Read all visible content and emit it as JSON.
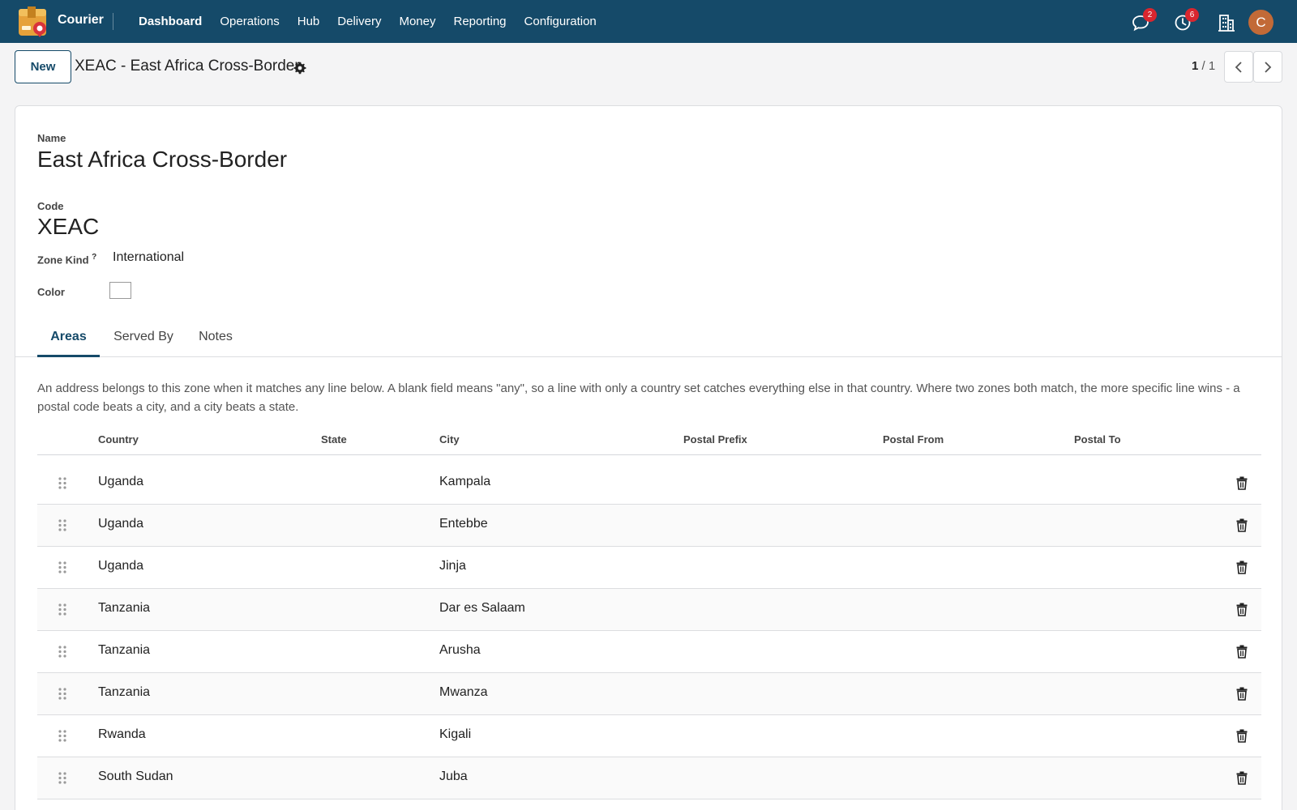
{
  "app": {
    "name": "Courier"
  },
  "menu": [
    {
      "label": "Dashboard",
      "active": true
    },
    {
      "label": "Operations"
    },
    {
      "label": "Hub"
    },
    {
      "label": "Delivery"
    },
    {
      "label": "Money"
    },
    {
      "label": "Reporting"
    },
    {
      "label": "Configuration"
    }
  ],
  "systray": {
    "messages_count": "2",
    "activities_count": "6",
    "avatar_initial": "C"
  },
  "control": {
    "new_label": "New",
    "breadcrumb": "XEAC - East Africa Cross-Border",
    "pager_current": "1",
    "pager_total": "/ 1"
  },
  "form": {
    "name_label": "Name",
    "name_value": "East Africa Cross-Border",
    "code_label": "Code",
    "code_value": "XEAC",
    "zone_kind_label": "Zone Kind",
    "zone_kind_help": "?",
    "zone_kind_value": "International",
    "color_label": "Color",
    "color_value": "#ffffff"
  },
  "tabs": [
    {
      "label": "Areas",
      "active": true
    },
    {
      "label": "Served By"
    },
    {
      "label": "Notes"
    }
  ],
  "areas_help": "An address belongs to this zone when it matches any line below. A blank field means \"any\", so a line with only a country set catches everything else in that country. Where two zones both match, the more specific line wins - a postal code beats a city, and a city beats a state.",
  "table": {
    "columns": [
      "Country",
      "State",
      "City",
      "Postal Prefix",
      "Postal From",
      "Postal To"
    ],
    "rows": [
      {
        "country": "Uganda",
        "state": "",
        "city": "Kampala",
        "prefix": "",
        "from": "",
        "to": ""
      },
      {
        "country": "Uganda",
        "state": "",
        "city": "Entebbe",
        "prefix": "",
        "from": "",
        "to": ""
      },
      {
        "country": "Uganda",
        "state": "",
        "city": "Jinja",
        "prefix": "",
        "from": "",
        "to": ""
      },
      {
        "country": "Tanzania",
        "state": "",
        "city": "Dar es Salaam",
        "prefix": "",
        "from": "",
        "to": ""
      },
      {
        "country": "Tanzania",
        "state": "",
        "city": "Arusha",
        "prefix": "",
        "from": "",
        "to": ""
      },
      {
        "country": "Tanzania",
        "state": "",
        "city": "Mwanza",
        "prefix": "",
        "from": "",
        "to": ""
      },
      {
        "country": "Rwanda",
        "state": "",
        "city": "Kigali",
        "prefix": "",
        "from": "",
        "to": ""
      },
      {
        "country": "South Sudan",
        "state": "",
        "city": "Juba",
        "prefix": "",
        "from": "",
        "to": ""
      }
    ]
  },
  "colors": {
    "navbar": "#154a69",
    "badge": "#d9262f",
    "avatar": "#c26a37"
  },
  "icons": {
    "app_logo": "courier-box-icon",
    "messages": "chat-bubble-icon",
    "activities": "clock-icon",
    "company": "building-icon",
    "settings": "gear-icon",
    "prev": "chevron-left-icon",
    "next": "chevron-right-icon",
    "drag": "drag-handle-icon",
    "delete": "trash-icon"
  }
}
